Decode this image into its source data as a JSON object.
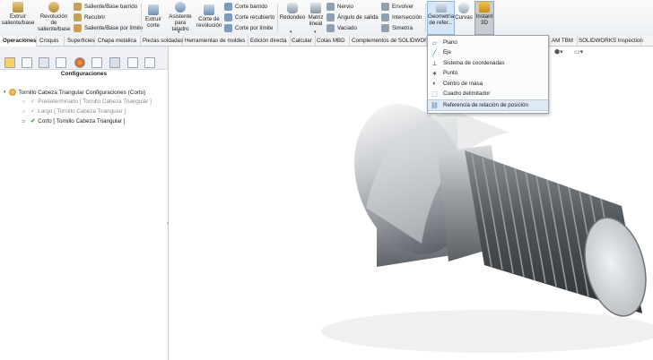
{
  "ribbon": {
    "extrude": "Extruir\nsaliente/base",
    "revolve": "Revolución\nde\nsaliente/base",
    "sweep": "Saliente/Base barrido",
    "loft": "Recubrir",
    "boundary": "Saliente/Base por límite",
    "extrude_cut": "Extruir\ncorte",
    "hole_wizard": "Asistente\npara taladro",
    "revolve_cut": "Corte de\nrevolución",
    "swept_cut": "Corte barrido",
    "lofted_cut": "Corte recubierto",
    "boundary_cut": "Corte por límite",
    "fillet": "Redondeo",
    "pattern": "Matriz\nlineal",
    "rib": "Nervio",
    "draft": "Ángulo de salida",
    "shell": "Vaciado",
    "wrap": "Envolver",
    "intersect": "Intersección",
    "mirror": "Simetría",
    "ref_geometry": "Geometría\nde refer...",
    "curves": "Curvas",
    "instant3d": "Instant\n3D"
  },
  "tabs": [
    "Operaciones",
    "Croquis",
    "Superficies",
    "Chapa metálica",
    "Piezas soldadas",
    "Herramientas de moldes",
    "Edición directa",
    "Calcular",
    "Cotas MBD",
    "Complementos de SOLIDWORKS",
    "AM TBM",
    "SOLIDWORKS Inspection"
  ],
  "panel": {
    "title": "Configuraciones",
    "root": "Tornillo Cabeza Triangular Configuraciones  (Corto)",
    "configs": [
      {
        "label": "Predeterminado [ Tornillo Cabeza Triangular ]",
        "active": false
      },
      {
        "label": "Largo [ Tornillo Cabeza Triangular ]",
        "active": false
      },
      {
        "label": "Corto [ Tornillo Cabeza Triangular ]",
        "active": true
      }
    ]
  },
  "menu": {
    "items": [
      "Plano",
      "Eje",
      "Sistema de coordenadas",
      "Punto",
      "Centro de masa",
      "Cuadro delimitador",
      "Referencia de relación de posición"
    ],
    "highlighted_index": 6
  },
  "colors": {
    "accent": "#2f7ac4",
    "check": "#2e9e2e"
  }
}
